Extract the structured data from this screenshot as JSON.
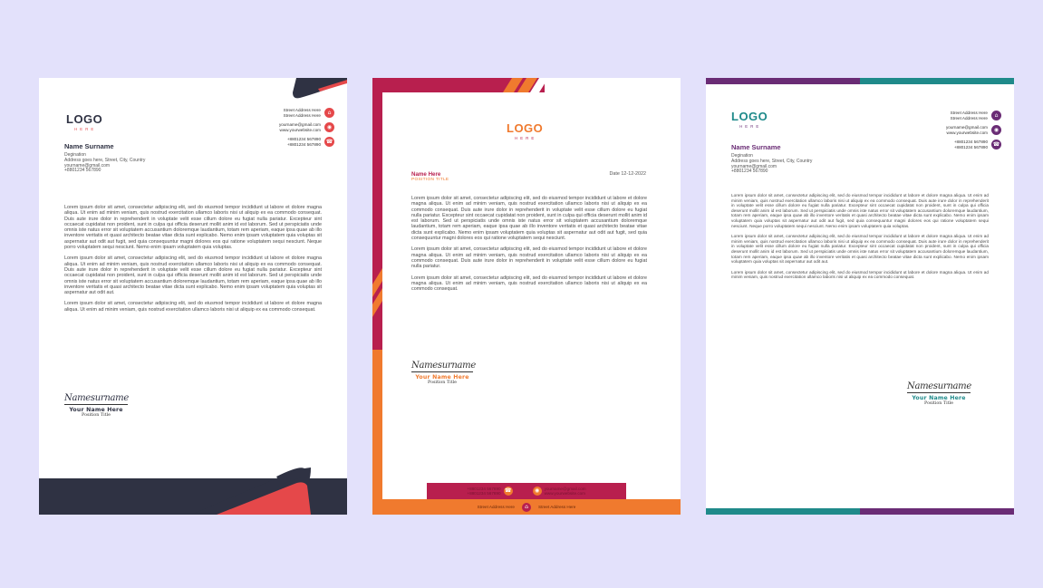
{
  "letterheads": [
    {
      "logo": "LOGO",
      "logo_sub": "H E R E",
      "contact": [
        {
          "text": "Street Address Here\nStreet Address Here",
          "icon": "home-icon"
        },
        {
          "text": "yourname@gmail.com\nwww.yourwebsite.com",
          "icon": "globe-icon"
        },
        {
          "text": "+8801234 567890\n+8801234 567890",
          "icon": "phone-icon"
        }
      ],
      "name": "Name Surname",
      "designation": "Degination",
      "address": "Address goes here, Street, City, Country",
      "email": "yourname@gmail.com",
      "phone": "+8801234 567890",
      "paragraphs": [
        "Lorem ipsum dolor sit amet, consectetur adipiscing elit, sed do eiusmod tempor incididunt ut labore et dolore magna aliqua. Ut enim ad minim veniam, quis nostrud exercitation ullamco laboris nisi ut aliquip ex ea commodo consequat. Duis aute irure dolor in reprehenderit in voluptate velit esse cillum dolore eu fugiat nulla pariatur. Excepteur sint occaecat cupidatat non proident, sunt in culpa qui officia deserunt mollit anim id est laborum. Sed ut perspiciatis unde omnis iste natus error sit voluptatem accusantium doloremque laudantium, totam rem aperiam, eaque ipsa quae ab illo inventore veritatis et quasi architecto beatae vitae dicta sunt explicabo. Nemo enim ipsam voluptatem quia voluptas sit aspernatur aut odit aut fugit, sed quia consequuntur magni dolores eos qui ratione voluptatem sequi nesciunt. Neque porro voluptatem sequi nesciunt. Nemo enim ipsam voluptatem quia voluptas.",
        "Lorem ipsum dolor sit amet, consectetur adipiscing elit, sed do eiusmod tempor incididunt ut labore et dolore magna aliqua. Ut enim ad minim veniam, quis nostrud exercitation ullamco laboris nisi ut aliquip ex ea commodo consequat. Duis aute irure dolor in reprehenderit in voluptate velit esse cillum dolore eu fugiat nulla pariatur. Excepteur sint occaecat cupidatat non proident, sunt in culpa qui officia deserunt mollit anim id est laborum. Sed ut perspiciatis unde omnis iste natus error sit voluptatem accusantium doloremque laudantium, totam rem aperiam, eaque ipsa quae ab illo inventore veritatis et quasi architecto beatae vitae dicta sunt explicabo. Nemo enim ipsam voluptatem quia voluptas sit aspernatur aut odit aut.",
        "Lorem ipsum dolor sit amet, consectetur adipiscing elit, sed do eiusmod tempor incididunt ut labore et dolore magna aliqua. Ut enim ad minim veniam, quis nostrud exercitation ullamco laboris nisi ut aliquip ex ea commodo consequat."
      ],
      "signature": "Namesurname",
      "sig_name": "Your Name Here",
      "sig_title": "Position Title",
      "colors": {
        "dark": "#2f3243",
        "accent": "#e5484a",
        "logo": "#2f3243",
        "logo_sub": "#e5484a"
      }
    },
    {
      "logo": "LOGO",
      "logo_sub": "H E R E",
      "name": "Name Here",
      "position": "POSITION TITLE",
      "date": "Date 12-12-2022",
      "paragraphs": [
        "Lorem ipsum dolor sit amet, consectetur adipiscing elit, sed do eiusmod tempor incididunt ut labore et dolore magna aliqua. Ut enim ad minim veniam, quis nostrud exercitation ullamco laboris nisi ut aliquip ex ea commodo consequat. Duis aute irure dolor in reprehenderit in voluptate velit esse cillum dolore eu fugiat nulla pariatur. Excepteur sint occaecat cupidatat non proident, sunt in culpa qui officia deserunt mollit anim id est laborum. Sed ut perspiciatis unde omnis iste natus error sit voluptatem accusantium doloremque laudantium, totam rem aperiam, eaque ipsa quae ab illo inventore veritatis et quasi architecto beatae vitae dicta sunt explicabo. Nemo enim ipsam voluptatem quia voluptas sit aspernatur aut odit aut fugit, sed quia consequuntur magni dolores eos qui ratione voluptatem sequi nesciunt.",
        "Lorem ipsum dolor sit amet, consectetur adipiscing elit, sed do eiusmod tempor incididunt ut labore et dolore magna aliqua. Ut enim ad minim veniam, quis nostrud exercitation ullamco laboris nisi ut aliquip ex ea commodo consequat. Duis aute irure dolor in reprehenderit in voluptate velit esse cillum dolore eu fugiat nulla pariatur.",
        "Lorem ipsum dolor sit amet, consectetur adipiscing elit, sed do eiusmod tempor incididunt ut labore et dolore magna aliqua. Ut enim ad minim veniam, quis nostrud exercitation ullamco laboris nisi ut aliquip ex ea commodo consequat."
      ],
      "signature": "Namesurname",
      "sig_name": "Your Name Here",
      "sig_title": "Position Title",
      "footer_left": "+8801234 567890\n+8801234 567890",
      "footer_right": "yourname@gmail.com\nwww.yourwebsite.com",
      "footer_address_left": "Street Address Here",
      "footer_address_right": "Street Address Here",
      "colors": {
        "crimson": "#b81f4e",
        "orange": "#f07a2e",
        "logo": "#f07a2e",
        "logo_sub": "#b81f4e"
      }
    },
    {
      "logo": "LOGO",
      "logo_sub": "H E R E",
      "contact": [
        {
          "text": "Street Address Here\nStreet Address Here",
          "icon": "home-icon"
        },
        {
          "text": "yourname@gmail.com\nwww.yourwebsite.com",
          "icon": "globe-icon"
        },
        {
          "text": "+8801234 567890\n+8801234 567890",
          "icon": "phone-icon"
        }
      ],
      "name": "Name Surname",
      "designation": "Degination",
      "address": "Address goes here, Street, City, Country",
      "email": "yourname@gmail.com",
      "phone": "+8801234 567890",
      "paragraphs": [
        "Lorem ipsum dolor sit amet, consectetur adipiscing elit, sed do eiusmod tempor incididunt ut labore et dolore magna aliqua. Ut enim ad minim veniam, quis nostrud exercitation ullamco laboris nisi ut aliquip ex ea commodo consequat. Duis aute irure dolor in reprehenderit in voluptate velit esse cillum dolore eu fugiat nulla pariatur. Excepteur sint occaecat cupidatat non proident, sunt in culpa qui officia deserunt mollit anim id est laborum. Sed ut perspiciatis unde omnis iste natus error sit voluptatem accusantium doloremque laudantium, totam rem aperiam, eaque ipsa quae ab illo inventore veritatis et quasi architecto beatae vitae dicta sunt explicabo. Nemo enim ipsam voluptatem quia voluptas sit aspernatur aut odit aut fugit, sed quia consequuntur magni dolores eos qui ratione voluptatem sequi nesciunt. Neque porro voluptatem sequi nesciunt. Nemo enim ipsam voluptatem quia voluptas.",
        "Lorem ipsum dolor sit amet, consectetur adipiscing elit, sed do eiusmod tempor incididunt ut labore et dolore magna aliqua. Ut enim ad minim veniam, quis nostrud exercitation ullamco laboris nisi ut aliquip ex ea commodo consequat. Duis aute irure dolor in reprehenderit in voluptate velit esse cillum dolore eu fugiat nulla pariatur. Excepteur sint occaecat cupidatat non proident, sunt in culpa qui officia deserunt mollit anim id est laborum. Sed ut perspiciatis unde omnis iste natus error sit voluptatem accusantium doloremque laudantium, totam rem aperiam, eaque ipsa quae ab illo inventore veritatis et quasi architecto beatae vitae dicta sunt explicabo. Nemo enim ipsam voluptatem quia voluptas sit aspernatur aut odit aut.",
        "Lorem ipsum dolor sit amet, consectetur adipiscing elit, sed do eiusmod tempor incididunt ut labore et dolore magna aliqua. Ut enim ad minim veniam, quis nostrud exercitation ullamco laboris nisi ut aliquip ex ea commodo consequat."
      ],
      "signature": "Namesurname",
      "sig_name": "Your Name Here",
      "sig_title": "Position Title",
      "colors": {
        "purple": "#6a2c75",
        "teal": "#1f8a8a",
        "logo": "#1f8a8a",
        "name": "#6a2c75"
      }
    }
  ]
}
